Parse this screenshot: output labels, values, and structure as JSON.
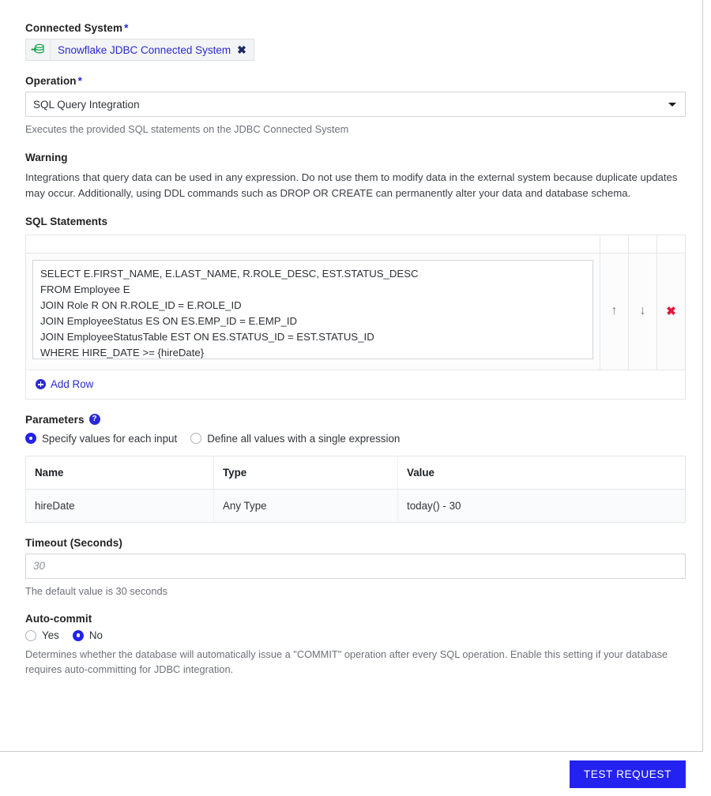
{
  "connected_system": {
    "label": "Connected System",
    "required_marker": "*",
    "chip_icon": "database-import-icon",
    "chip_label": "Snowflake JDBC Connected System",
    "chip_remove_icon": "✖"
  },
  "operation": {
    "label": "Operation",
    "required_marker": "*",
    "selected": "SQL Query Integration",
    "help": "Executes the provided SQL statements on the JDBC Connected System"
  },
  "warning": {
    "title": "Warning",
    "body": "Integrations that query data can be used in any expression. Do not use them to modify data in the external system because duplicate updates may occur. Additionally, using DDL commands such as DROP OR CREATE can permanently alter your data and database schema."
  },
  "sql_statements": {
    "label": "SQL Statements",
    "rows": [
      {
        "value": "SELECT E.FIRST_NAME, E.LAST_NAME, R.ROLE_DESC, EST.STATUS_DESC\nFROM Employee E\nJOIN Role R ON R.ROLE_ID = E.ROLE_ID\nJOIN EmployeeStatus ES ON ES.EMP_ID = E.EMP_ID\nJOIN EmployeeStatusTable EST ON ES.STATUS_ID = EST.STATUS_ID\nWHERE HIRE_DATE >= {hireDate}",
        "move_up_icon": "↑",
        "move_down_icon": "↓",
        "delete_icon": "✖"
      }
    ],
    "add_row_label": "Add Row"
  },
  "parameters": {
    "label": "Parameters",
    "help_icon": "?",
    "mode_options": [
      {
        "label": "Specify values for each input",
        "selected": true
      },
      {
        "label": "Define all values with a single expression",
        "selected": false
      }
    ],
    "columns": [
      "Name",
      "Type",
      "Value"
    ],
    "rows": [
      {
        "name": "hireDate",
        "type": "Any Type",
        "value": "today() - 30"
      }
    ]
  },
  "timeout": {
    "label": "Timeout (Seconds)",
    "value": "",
    "placeholder": "30",
    "help": "The default value is 30 seconds"
  },
  "auto_commit": {
    "label": "Auto-commit",
    "options": [
      {
        "label": "Yes",
        "selected": false
      },
      {
        "label": "No",
        "selected": true
      }
    ],
    "help": "Determines whether the database will automatically issue a \"COMMIT\" operation after every SQL operation. Enable this setting if your database requires auto-committing for JDBC integration."
  },
  "footer": {
    "test_request_label": "TEST REQUEST"
  },
  "colors": {
    "accent": "#2322f0",
    "link": "#2a2ad4",
    "danger": "#e3173e",
    "icon_green": "#16a34a",
    "border": "#d3d5d8"
  }
}
